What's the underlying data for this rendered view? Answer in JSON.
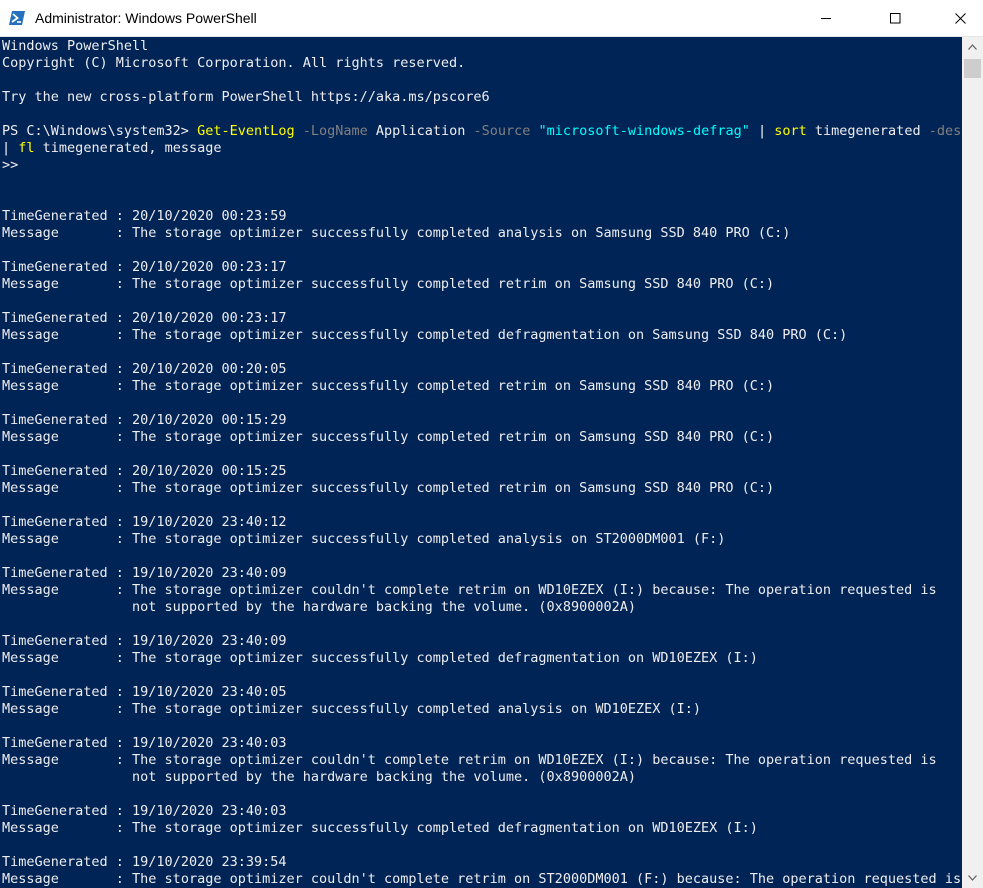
{
  "window": {
    "title": "Administrator: Windows PowerShell",
    "controls": {
      "minimize": "minimize",
      "maximize": "maximize",
      "close": "close"
    }
  },
  "colors": {
    "console_bg": "#012456",
    "foreground": "#eeedf0",
    "command": "#ffff00",
    "parameter": "#808080",
    "string": "#00ffff"
  },
  "console": {
    "header": [
      "Windows PowerShell",
      "Copyright (C) Microsoft Corporation. All rights reserved.",
      "",
      "Try the new cross-platform PowerShell https://aka.ms/pscore6",
      ""
    ],
    "command": {
      "prompt": "PS C:\\Windows\\system32> ",
      "tokens": [
        {
          "text": "Get-EventLog",
          "kind": "cmd"
        },
        {
          "text": " ",
          "kind": "default"
        },
        {
          "text": "-LogName",
          "kind": "param"
        },
        {
          "text": " Application ",
          "kind": "default"
        },
        {
          "text": "-Source",
          "kind": "param"
        },
        {
          "text": " ",
          "kind": "default"
        },
        {
          "text": "\"microsoft-windows-defrag\"",
          "kind": "str"
        },
        {
          "text": " ",
          "kind": "default"
        },
        {
          "text": "|",
          "kind": "op"
        },
        {
          "text": " ",
          "kind": "default"
        },
        {
          "text": "sort",
          "kind": "cmd"
        },
        {
          "text": " timegenerated ",
          "kind": "default"
        },
        {
          "text": "-desc",
          "kind": "param"
        }
      ],
      "continuation": [
        {
          "text": "|",
          "kind": "op"
        },
        {
          "text": " ",
          "kind": "default"
        },
        {
          "text": "fl",
          "kind": "cmd"
        },
        {
          "text": " timegenerated",
          "kind": "default"
        },
        {
          "text": ",",
          "kind": "default"
        },
        {
          "text": " message",
          "kind": "default"
        }
      ],
      "next_prompt": ">>"
    },
    "field_labels": {
      "time": "TimeGenerated : ",
      "message": "Message       : ",
      "indent": "                "
    },
    "records": [
      {
        "time": "20/10/2020 00:23:59",
        "message": [
          "The storage optimizer successfully completed analysis on Samsung SSD 840 PRO (C:)"
        ]
      },
      {
        "time": "20/10/2020 00:23:17",
        "message": [
          "The storage optimizer successfully completed retrim on Samsung SSD 840 PRO (C:)"
        ]
      },
      {
        "time": "20/10/2020 00:23:17",
        "message": [
          "The storage optimizer successfully completed defragmentation on Samsung SSD 840 PRO (C:)"
        ]
      },
      {
        "time": "20/10/2020 00:20:05",
        "message": [
          "The storage optimizer successfully completed retrim on Samsung SSD 840 PRO (C:)"
        ]
      },
      {
        "time": "20/10/2020 00:15:29",
        "message": [
          "The storage optimizer successfully completed retrim on Samsung SSD 840 PRO (C:)"
        ]
      },
      {
        "time": "20/10/2020 00:15:25",
        "message": [
          "The storage optimizer successfully completed retrim on Samsung SSD 840 PRO (C:)"
        ]
      },
      {
        "time": "19/10/2020 23:40:12",
        "message": [
          "The storage optimizer successfully completed analysis on ST2000DM001 (F:)"
        ]
      },
      {
        "time": "19/10/2020 23:40:09",
        "message": [
          "The storage optimizer couldn't complete retrim on WD10EZEX (I:) because: The operation requested is",
          "not supported by the hardware backing the volume. (0x8900002A)"
        ]
      },
      {
        "time": "19/10/2020 23:40:09",
        "message": [
          "The storage optimizer successfully completed defragmentation on WD10EZEX (I:)"
        ]
      },
      {
        "time": "19/10/2020 23:40:05",
        "message": [
          "The storage optimizer successfully completed analysis on WD10EZEX (I:)"
        ]
      },
      {
        "time": "19/10/2020 23:40:03",
        "message": [
          "The storage optimizer couldn't complete retrim on WD10EZEX (I:) because: The operation requested is",
          "not supported by the hardware backing the volume. (0x8900002A)"
        ]
      },
      {
        "time": "19/10/2020 23:40:03",
        "message": [
          "The storage optimizer successfully completed defragmentation on WD10EZEX (I:)"
        ]
      },
      {
        "time": "19/10/2020 23:39:54",
        "message": [
          "The storage optimizer couldn't complete retrim on ST2000DM001 (F:) because: The operation requested is"
        ]
      }
    ]
  }
}
